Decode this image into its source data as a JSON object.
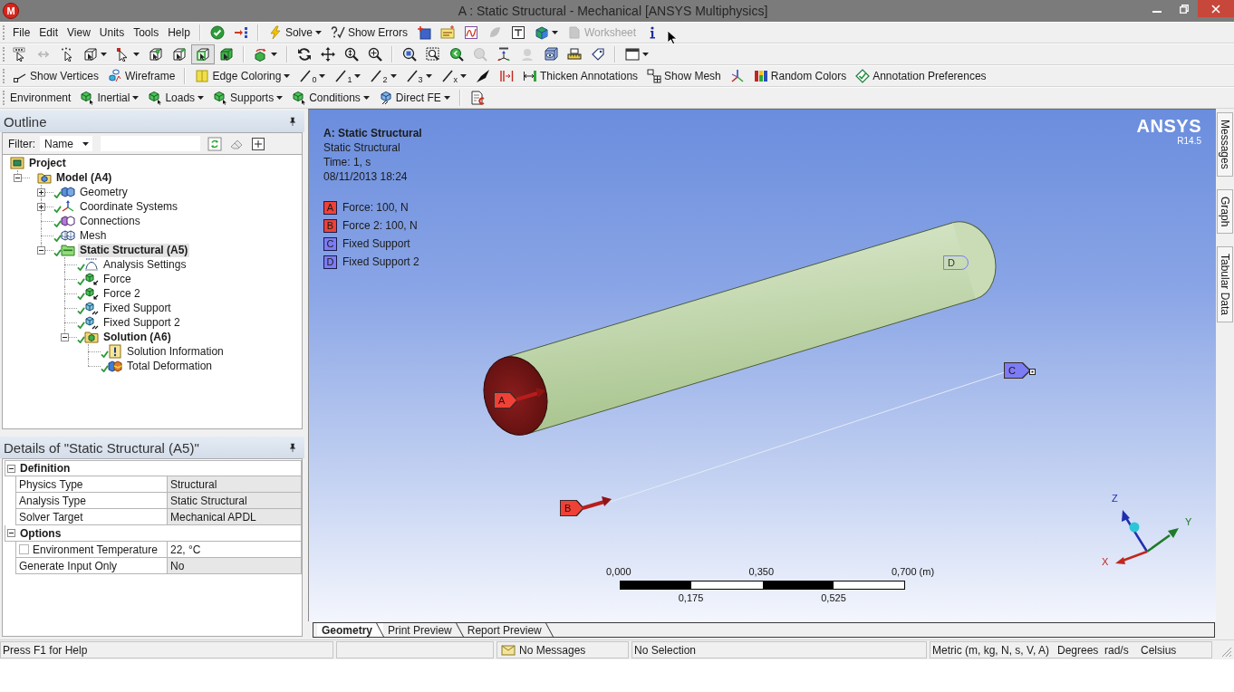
{
  "window": {
    "logo": "M",
    "title": "A : Static Structural - Mechanical [ANSYS Multiphysics]"
  },
  "menu": [
    {
      "label": "File"
    },
    {
      "label": "Edit"
    },
    {
      "label": "View"
    },
    {
      "label": "Units"
    },
    {
      "label": "Tools"
    },
    {
      "label": "Help"
    }
  ],
  "toolbars": [
    [
      {
        "kind": "separator"
      },
      {
        "kind": "tool",
        "dropdown": false,
        "disabled": false
      },
      {
        "kind": "tool",
        "dropdown": false,
        "disabled": false
      },
      {
        "kind": "separator"
      },
      {
        "kind": "button",
        "label": "Solve",
        "dropdown": true,
        "disabled": false
      },
      {
        "kind": "button",
        "label": "Show Errors",
        "dropdown": false,
        "disabled": false
      },
      {
        "kind": "tool",
        "dropdown": false,
        "disabled": false
      },
      {
        "kind": "tool",
        "dropdown": false,
        "disabled": false
      },
      {
        "kind": "tool",
        "dropdown": false,
        "disabled": false
      },
      {
        "kind": "tool",
        "dropdown": false,
        "disabled": true
      },
      {
        "kind": "tool",
        "dropdown": false,
        "disabled": false
      },
      {
        "kind": "tool",
        "dropdown": true,
        "disabled": false
      },
      {
        "kind": "button",
        "label": "Worksheet",
        "dropdown": false,
        "disabled": true
      },
      {
        "kind": "tool",
        "dropdown": false,
        "disabled": false
      }
    ],
    [
      {
        "kind": "tool",
        "dropdown": false,
        "disabled": false,
        "selected": false
      },
      {
        "kind": "tool",
        "dropdown": false,
        "disabled": true,
        "selected": false
      },
      {
        "kind": "tool",
        "dropdown": false,
        "disabled": false,
        "selected": false
      },
      {
        "kind": "tool",
        "dropdown": true,
        "disabled": false,
        "selected": false
      },
      {
        "kind": "tool",
        "dropdown": true,
        "disabled": false,
        "selected": false
      },
      {
        "kind": "tool",
        "dropdown": false,
        "disabled": false,
        "selected": false
      },
      {
        "kind": "tool",
        "dropdown": false,
        "disabled": false,
        "selected": false
      },
      {
        "kind": "tool",
        "dropdown": false,
        "disabled": false,
        "selected": true
      },
      {
        "kind": "tool",
        "dropdown": false,
        "disabled": false,
        "selected": false
      },
      {
        "kind": "separator"
      },
      {
        "kind": "tool",
        "dropdown": true,
        "disabled": false,
        "selected": false
      },
      {
        "kind": "separator"
      },
      {
        "kind": "tool",
        "dropdown": false,
        "disabled": false,
        "selected": false
      },
      {
        "kind": "tool",
        "dropdown": false,
        "disabled": false,
        "selected": false
      },
      {
        "kind": "tool",
        "dropdown": false,
        "disabled": false,
        "selected": false
      },
      {
        "kind": "tool",
        "dropdown": false,
        "disabled": false,
        "selected": false
      },
      {
        "kind": "separator"
      },
      {
        "kind": "tool",
        "dropdown": false,
        "disabled": false,
        "selected": false
      },
      {
        "kind": "tool",
        "dropdown": false,
        "disabled": false,
        "selected": false
      },
      {
        "kind": "tool",
        "dropdown": false,
        "disabled": false,
        "selected": false
      },
      {
        "kind": "tool",
        "dropdown": false,
        "disabled": true,
        "selected": false
      },
      {
        "kind": "tool",
        "dropdown": false,
        "disabled": false,
        "selected": false
      },
      {
        "kind": "tool",
        "dropdown": false,
        "disabled": true,
        "selected": false
      },
      {
        "kind": "tool",
        "dropdown": false,
        "disabled": false,
        "selected": false
      },
      {
        "kind": "tool",
        "dropdown": false,
        "disabled": false,
        "selected": false
      },
      {
        "kind": "tool",
        "dropdown": false,
        "disabled": false,
        "selected": false
      },
      {
        "kind": "separator"
      },
      {
        "kind": "tool",
        "dropdown": true,
        "disabled": false,
        "selected": false
      }
    ],
    [
      {
        "kind": "button",
        "label": "Show Vertices",
        "dropdown": false
      },
      {
        "kind": "button",
        "label": "Wireframe",
        "dropdown": false
      },
      {
        "kind": "separator"
      },
      {
        "kind": "button",
        "label": "Edge Coloring",
        "dropdown": true
      },
      {
        "kind": "tool",
        "subscript": "0",
        "dropdown": true
      },
      {
        "kind": "tool",
        "subscript": "1",
        "dropdown": true
      },
      {
        "kind": "tool",
        "subscript": "2",
        "dropdown": true
      },
      {
        "kind": "tool",
        "subscript": "3",
        "dropdown": true
      },
      {
        "kind": "tool",
        "subscript": "x",
        "dropdown": true
      },
      {
        "kind": "tool",
        "dropdown": false
      },
      {
        "kind": "tool",
        "dropdown": false
      },
      {
        "kind": "button",
        "label": "Thicken Annotations",
        "dropdown": false
      },
      {
        "kind": "button",
        "label": "Show Mesh",
        "dropdown": false
      },
      {
        "kind": "tool",
        "dropdown": false
      },
      {
        "kind": "button",
        "label": "Random Colors",
        "dropdown": false
      },
      {
        "kind": "button",
        "label": "Annotation Preferences",
        "dropdown": false
      }
    ],
    [
      {
        "kind": "label",
        "label": "Environment"
      },
      {
        "kind": "button",
        "label": "Inertial",
        "dropdown": true
      },
      {
        "kind": "button",
        "label": "Loads",
        "dropdown": true
      },
      {
        "kind": "button",
        "label": "Supports",
        "dropdown": true
      },
      {
        "kind": "button",
        "label": "Conditions",
        "dropdown": true
      },
      {
        "kind": "button",
        "label": "Direct FE",
        "dropdown": true
      },
      {
        "kind": "separator"
      },
      {
        "kind": "tool",
        "dropdown": false
      }
    ]
  ],
  "outline": {
    "title": "Outline",
    "filter": {
      "label": "Filter:",
      "field": "Name"
    },
    "tree": [
      {
        "label": "Project",
        "kind": "project",
        "ok": false,
        "selected": false,
        "children": [
          {
            "label": "Model (A4)",
            "kind": "model",
            "ok": false,
            "selected": false,
            "expanded": true,
            "children": [
              {
                "label": "Geometry",
                "kind": "geometry",
                "ok": true,
                "selected": false,
                "expanded": false
              },
              {
                "label": "Coordinate Systems",
                "kind": "coordinate_systems",
                "ok": true,
                "selected": false,
                "expanded": false
              },
              {
                "label": "Connections",
                "kind": "connections",
                "ok": true,
                "selected": false
              },
              {
                "label": "Mesh",
                "kind": "mesh",
                "ok": true,
                "selected": false
              },
              {
                "label": "Static Structural (A5)",
                "kind": "environment",
                "ok": true,
                "selected": true,
                "expanded": true,
                "children": [
                  {
                    "label": "Analysis Settings",
                    "kind": "analysis_settings",
                    "ok": true,
                    "selected": false
                  },
                  {
                    "label": "Force",
                    "kind": "force",
                    "ok": true,
                    "selected": false
                  },
                  {
                    "label": "Force 2",
                    "kind": "force",
                    "ok": true,
                    "selected": false
                  },
                  {
                    "label": "Fixed Support",
                    "kind": "support",
                    "ok": true,
                    "selected": false
                  },
                  {
                    "label": "Fixed Support 2",
                    "kind": "support",
                    "ok": true,
                    "selected": false
                  },
                  {
                    "label": "Solution (A6)",
                    "kind": "solution",
                    "ok": true,
                    "selected": false,
                    "expanded": true,
                    "children": [
                      {
                        "label": "Solution Information",
                        "kind": "solution_information",
                        "ok": true,
                        "selected": false
                      },
                      {
                        "label": "Total Deformation",
                        "kind": "result",
                        "ok": true,
                        "selected": false
                      }
                    ]
                  }
                ]
              }
            ]
          }
        ]
      }
    ]
  },
  "details": {
    "title": "Details of \"Static Structural (A5)\"",
    "groups": [
      {
        "name": "Definition",
        "expanded": true,
        "rows": [
          {
            "kind": "property",
            "name": "Physics Type",
            "value": "Structural",
            "read_only": true
          },
          {
            "kind": "property",
            "name": "Analysis Type",
            "value": "Static Structural",
            "read_only": true
          },
          {
            "kind": "property",
            "name": "Solver Target",
            "value": "Mechanical APDL",
            "read_only": true
          }
        ]
      },
      {
        "name": "Options",
        "expanded": true,
        "rows": [
          {
            "kind": "parameter",
            "name": "Environment Temperature",
            "value": "22, °C",
            "read_only": false,
            "checked": false
          },
          {
            "kind": "property",
            "name": "Generate Input Only",
            "value": "No",
            "read_only": true
          }
        ]
      }
    ]
  },
  "viewport": {
    "heading": "A: Static Structural",
    "info": [
      "Static Structural",
      "Time: 1, s",
      "08/11/2013 18:24"
    ],
    "legend": [
      {
        "letter": "A",
        "label": "Force: 100, N",
        "color": "#ef4136"
      },
      {
        "letter": "B",
        "label": "Force 2: 100, N",
        "color": "#ef4136"
      },
      {
        "letter": "C",
        "label": "Fixed Support",
        "color": "#7c7cf4"
      },
      {
        "letter": "D",
        "label": "Fixed Support 2",
        "color": "#7c7cf4"
      }
    ],
    "logo": "ANSYS",
    "version": "R14.5",
    "markers": [
      {
        "letter": "A",
        "kind": "force",
        "hidden": false
      },
      {
        "letter": "B",
        "kind": "force",
        "hidden": false
      },
      {
        "letter": "C",
        "kind": "support",
        "hidden": false
      },
      {
        "letter": "D",
        "kind": "support",
        "hidden": true
      }
    ],
    "scale_bar": {
      "top_labels": [
        "0,000",
        "0,350",
        "0,700 (m)"
      ],
      "bottom_labels": [
        "0,175",
        "0,525"
      ]
    },
    "triad": {
      "x": "X",
      "y": "Y",
      "z": "Z"
    }
  },
  "view_tabs": [
    {
      "label": "Geometry",
      "selected": true
    },
    {
      "label": "Print Preview",
      "selected": false
    },
    {
      "label": "Report Preview",
      "selected": false
    }
  ],
  "side_tabs": [
    {
      "label": "Messages"
    },
    {
      "label": "Graph"
    },
    {
      "label": "Tabular Data"
    }
  ],
  "status_bar": {
    "help": "Press F1 for Help",
    "messages": "No Messages",
    "selection": "No Selection",
    "units": "Metric (m, kg, N, s, V, A)",
    "angle": "Degrees",
    "angular_velocity": "rad/s",
    "temperature": "Celsius"
  }
}
